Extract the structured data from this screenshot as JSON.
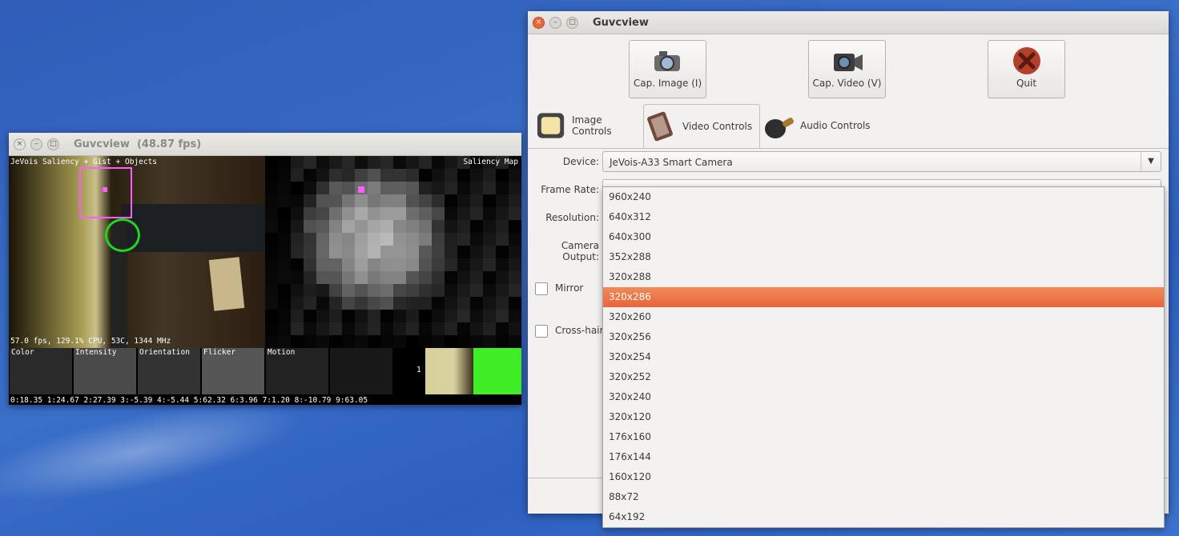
{
  "preview": {
    "title": "Guvcview",
    "fps": "(48.87 fps)",
    "overlay_top_left": "JeVois Saliency + Gist + Objects",
    "overlay_top_right": "Saliency Map",
    "overlay_status": "57.0 fps, 129.1% CPU, 53C, 1344 MHz",
    "thumb_labels": [
      "Color",
      "Intensity",
      "Orientation",
      "Flicker",
      "Motion"
    ],
    "object_count": "1",
    "gist_line": "0:18.35 1:24.67 2:27.39 3:-5.39 4:-5.44 5:62.32 6:3.96 7:1.20 8:-10.79 9:63.05"
  },
  "controls": {
    "title": "Guvcview",
    "buttons": {
      "cap_image": "Cap. Image (I)",
      "cap_video": "Cap. Video (V)",
      "quit": "Quit"
    },
    "tabs": {
      "image": "Image Controls",
      "video": "Video Controls",
      "audio": "Audio Controls"
    },
    "fields": {
      "device_label": "Device:",
      "device_value": "JeVois-A33 Smart Camera",
      "frame_rate_label": "Frame Rate:",
      "resolution_label": "Resolution:",
      "output_label": "Camera Output:",
      "mirror_label": "Mirror",
      "crosshair_label": "Cross-hair"
    }
  },
  "resolution_options": [
    "960x240",
    "640x312",
    "640x300",
    "352x288",
    "320x288",
    "320x286",
    "320x260",
    "320x256",
    "320x254",
    "320x252",
    "320x240",
    "320x120",
    "176x160",
    "176x144",
    "160x120",
    "88x72",
    "64x192"
  ],
  "selected_resolution": "320x286",
  "colors": {
    "selection": "#e9653a",
    "desktop": "#3a6fc9",
    "tracking_box": "#ff5cff",
    "tracking_ring": "#1dd81d"
  }
}
